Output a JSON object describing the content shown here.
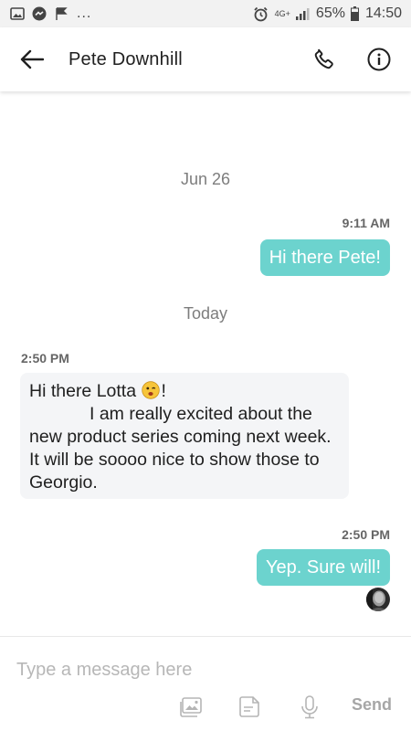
{
  "status_bar": {
    "overflow_indicator": "...",
    "network": "4G+",
    "battery": "65%",
    "time": "14:50"
  },
  "header": {
    "contact_name": "Pete Downhill",
    "icons": [
      "back-arrow-icon",
      "phone-icon",
      "info-icon"
    ]
  },
  "conversation": {
    "items": [
      {
        "type": "date",
        "text": "Jun 26"
      },
      {
        "type": "outgoing",
        "time": "9:11 AM",
        "text": "Hi there Pete!"
      },
      {
        "type": "date",
        "text": "Today"
      },
      {
        "type": "incoming",
        "time": "2:50 PM",
        "line1_before_emoji": "Hi there Lotta ",
        "emoji": "winking-face-emoji",
        "line1_after_emoji": "!",
        "body": "I am really excited about the new product series coming next week. It will be soooo nice to show those to Georgio."
      },
      {
        "type": "outgoing",
        "time": "2:50 PM",
        "text": "Yep. Sure will!",
        "read_receipt": "avatar"
      }
    ]
  },
  "composer": {
    "placeholder": "Type a message here",
    "send_label": "Send",
    "tools": [
      "gallery-icon",
      "sticker-icon",
      "microphone-icon"
    ]
  },
  "colors": {
    "outgoing_bubble": "#6cd3ce",
    "incoming_bubble": "#f4f5f7",
    "header_bg": "#ffffff",
    "status_bar_bg": "#f2f2f2"
  }
}
